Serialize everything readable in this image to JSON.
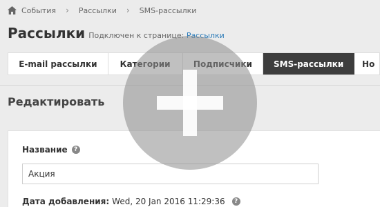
{
  "breadcrumb": {
    "home_icon": "home-icon",
    "items": [
      "События",
      "Рассылки",
      "SMS-рассылки"
    ]
  },
  "header": {
    "title": "Рассылки",
    "connected_text": "Подключен к странице:",
    "connected_link": "Рассылки"
  },
  "tabs": [
    {
      "label": "E-mail рассылки",
      "active": false
    },
    {
      "label": "Категории",
      "active": false
    },
    {
      "label": "Подписчики",
      "active": false
    },
    {
      "label": "SMS-рассылки",
      "active": true
    },
    {
      "label": "Но",
      "active": false
    }
  ],
  "section": {
    "title": "Редактировать"
  },
  "form": {
    "name_label": "Название",
    "name_value": "Акция",
    "date_label": "Дата добавления:",
    "date_value": "Wed, 20 Jan 2016 11:29:36",
    "help_icon": "question-circle-icon"
  },
  "overlay": {
    "icon": "plus-icon"
  },
  "colors": {
    "active_tab": "#3d3d3d",
    "link": "#2a7ab8",
    "background": "#ececec"
  }
}
